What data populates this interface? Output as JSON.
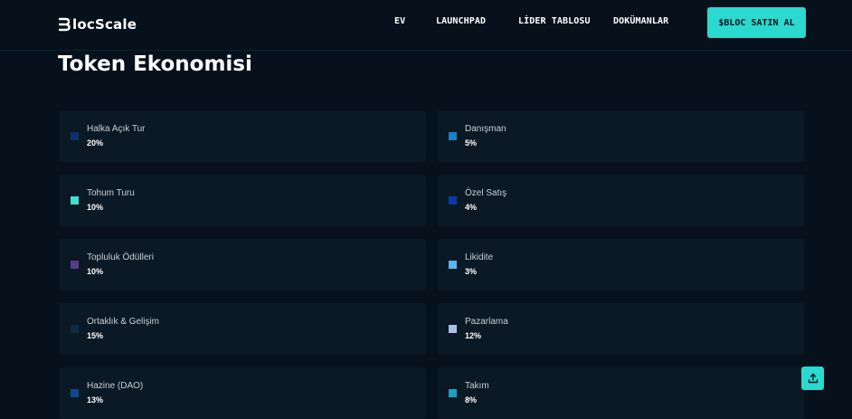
{
  "header": {
    "logo_text": "locScale",
    "logo_icon": "bloc-b-mark-icon",
    "nav": [
      {
        "label": "EV"
      },
      {
        "label": "LAUNCHPAD"
      },
      {
        "label": "LİDER TABLOSU"
      },
      {
        "label": "DOKÜMANLAR"
      }
    ],
    "buy_label": "$BLOC SATIN AL"
  },
  "main": {
    "title": "Token Ekonomisi",
    "allocations": [
      {
        "name": "Halka Açık Tur",
        "value": "20%",
        "color": "#0f2e6b"
      },
      {
        "name": "Danışman",
        "value": "5%",
        "color": "#1d7fc4"
      },
      {
        "name": "Tohum Turu",
        "value": "10%",
        "color": "#3ee0d0"
      },
      {
        "name": "Özel Satış",
        "value": "4%",
        "color": "#0a3aa6"
      },
      {
        "name": "Topluluk Ödülleri",
        "value": "10%",
        "color": "#5a3a8a"
      },
      {
        "name": "Likidite",
        "value": "3%",
        "color": "#5ab4f0"
      },
      {
        "name": "Ortaklık & Gelişim",
        "value": "15%",
        "color": "#0f2a44"
      },
      {
        "name": "Pazarlama",
        "value": "12%",
        "color": "#a9bfe8"
      },
      {
        "name": "Hazine (DAO)",
        "value": "13%",
        "color": "#0e4a8c"
      },
      {
        "name": "Takım",
        "value": "8%",
        "color": "#1d9fc0"
      }
    ]
  },
  "scroll_top_icon": "upload-arrow-icon",
  "colors": {
    "background": "#06111b",
    "card": "#0b1924",
    "accent": "#2bd9cf"
  }
}
